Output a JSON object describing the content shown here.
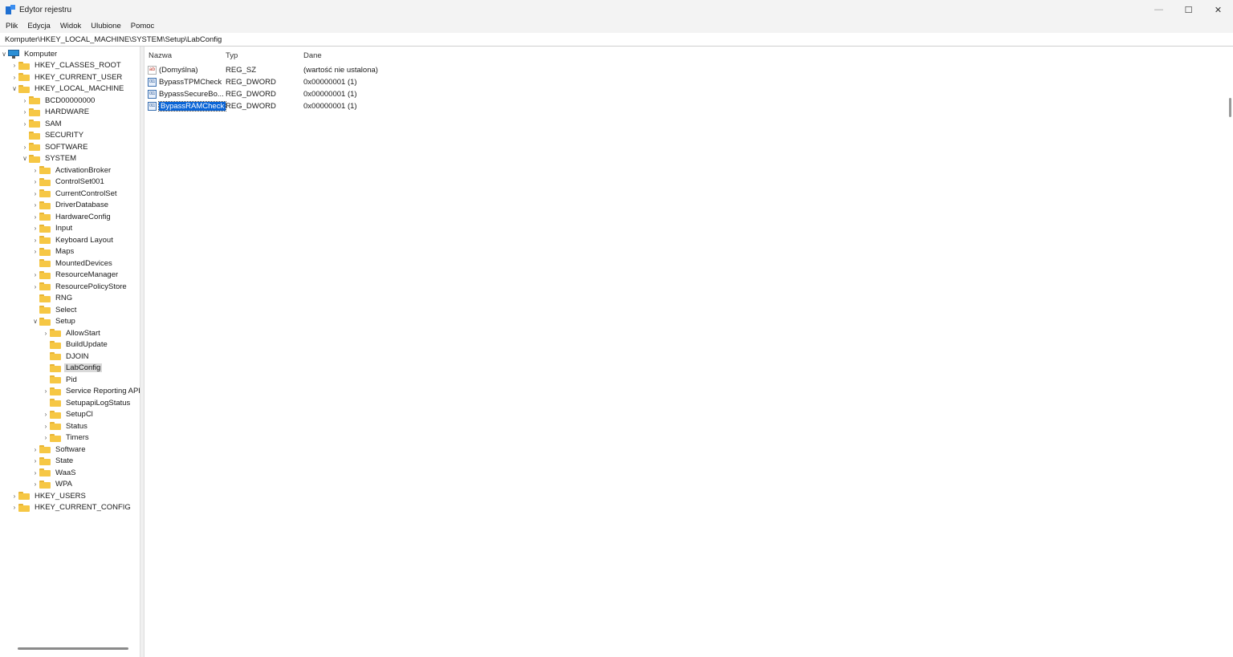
{
  "window": {
    "title": "Edytor rejestru",
    "controls": {
      "minimize": "—",
      "maximize": "☐",
      "close": "✕"
    }
  },
  "menu": [
    "Plik",
    "Edycja",
    "Widok",
    "Ulubione",
    "Pomoc"
  ],
  "address": "Komputer\\HKEY_LOCAL_MACHINE\\SYSTEM\\Setup\\LabConfig",
  "tree": [
    {
      "label": "Komputer",
      "depth": 0,
      "expander": "open",
      "icon": "computer-icon"
    },
    {
      "label": "HKEY_CLASSES_ROOT",
      "depth": 1,
      "expander": "closed",
      "icon": "folder-icon"
    },
    {
      "label": "HKEY_CURRENT_USER",
      "depth": 1,
      "expander": "closed",
      "icon": "folder-icon"
    },
    {
      "label": "HKEY_LOCAL_MACHINE",
      "depth": 1,
      "expander": "open",
      "icon": "folder-icon"
    },
    {
      "label": "BCD00000000",
      "depth": 2,
      "expander": "closed",
      "icon": "folder-icon"
    },
    {
      "label": "HARDWARE",
      "depth": 2,
      "expander": "closed",
      "icon": "folder-icon"
    },
    {
      "label": "SAM",
      "depth": 2,
      "expander": "closed",
      "icon": "folder-icon"
    },
    {
      "label": "SECURITY",
      "depth": 2,
      "expander": "none",
      "icon": "folder-icon"
    },
    {
      "label": "SOFTWARE",
      "depth": 2,
      "expander": "closed",
      "icon": "folder-icon"
    },
    {
      "label": "SYSTEM",
      "depth": 2,
      "expander": "open",
      "icon": "folder-icon"
    },
    {
      "label": "ActivationBroker",
      "depth": 3,
      "expander": "closed",
      "icon": "folder-icon"
    },
    {
      "label": "ControlSet001",
      "depth": 3,
      "expander": "closed",
      "icon": "folder-icon"
    },
    {
      "label": "CurrentControlSet",
      "depth": 3,
      "expander": "closed",
      "icon": "folder-icon"
    },
    {
      "label": "DriverDatabase",
      "depth": 3,
      "expander": "closed",
      "icon": "folder-icon"
    },
    {
      "label": "HardwareConfig",
      "depth": 3,
      "expander": "closed",
      "icon": "folder-icon"
    },
    {
      "label": "Input",
      "depth": 3,
      "expander": "closed",
      "icon": "folder-icon"
    },
    {
      "label": "Keyboard Layout",
      "depth": 3,
      "expander": "closed",
      "icon": "folder-icon"
    },
    {
      "label": "Maps",
      "depth": 3,
      "expander": "closed",
      "icon": "folder-icon"
    },
    {
      "label": "MountedDevices",
      "depth": 3,
      "expander": "none",
      "icon": "folder-icon"
    },
    {
      "label": "ResourceManager",
      "depth": 3,
      "expander": "closed",
      "icon": "folder-icon"
    },
    {
      "label": "ResourcePolicyStore",
      "depth": 3,
      "expander": "closed",
      "icon": "folder-icon"
    },
    {
      "label": "RNG",
      "depth": 3,
      "expander": "none",
      "icon": "folder-icon"
    },
    {
      "label": "Select",
      "depth": 3,
      "expander": "none",
      "icon": "folder-icon"
    },
    {
      "label": "Setup",
      "depth": 3,
      "expander": "open",
      "icon": "folder-icon"
    },
    {
      "label": "AllowStart",
      "depth": 4,
      "expander": "closed",
      "icon": "folder-icon"
    },
    {
      "label": "BuildUpdate",
      "depth": 4,
      "expander": "none",
      "icon": "folder-icon"
    },
    {
      "label": "DJOIN",
      "depth": 4,
      "expander": "none",
      "icon": "folder-icon"
    },
    {
      "label": "LabConfig",
      "depth": 4,
      "expander": "none",
      "icon": "folder-icon",
      "selected": true
    },
    {
      "label": "Pid",
      "depth": 4,
      "expander": "none",
      "icon": "folder-icon"
    },
    {
      "label": "Service Reporting API",
      "depth": 4,
      "expander": "closed",
      "icon": "folder-icon"
    },
    {
      "label": "SetupapiLogStatus",
      "depth": 4,
      "expander": "none",
      "icon": "folder-icon"
    },
    {
      "label": "SetupCl",
      "depth": 4,
      "expander": "closed",
      "icon": "folder-icon"
    },
    {
      "label": "Status",
      "depth": 4,
      "expander": "closed",
      "icon": "folder-icon"
    },
    {
      "label": "Timers",
      "depth": 4,
      "expander": "closed",
      "icon": "folder-icon"
    },
    {
      "label": "Software",
      "depth": 3,
      "expander": "closed",
      "icon": "folder-icon"
    },
    {
      "label": "State",
      "depth": 3,
      "expander": "closed",
      "icon": "folder-icon"
    },
    {
      "label": "WaaS",
      "depth": 3,
      "expander": "closed",
      "icon": "folder-icon"
    },
    {
      "label": "WPA",
      "depth": 3,
      "expander": "closed",
      "icon": "folder-icon"
    },
    {
      "label": "HKEY_USERS",
      "depth": 1,
      "expander": "closed",
      "icon": "folder-icon"
    },
    {
      "label": "HKEY_CURRENT_CONFIG",
      "depth": 1,
      "expander": "closed",
      "icon": "folder-icon"
    }
  ],
  "list": {
    "columns": {
      "name": "Nazwa",
      "type": "Typ",
      "data": "Dane"
    },
    "rows": [
      {
        "name": "(Domyślna)",
        "type": "REG_SZ",
        "data": "(wartość nie ustalona)",
        "icon": "string-value-icon",
        "glyph": "ab"
      },
      {
        "name": "BypassTPMCheck",
        "type": "REG_DWORD",
        "data": "0x00000001 (1)",
        "icon": "dword-value-icon",
        "glyph": "011"
      },
      {
        "name": "BypassSecureBo...",
        "type": "REG_DWORD",
        "data": "0x00000001 (1)",
        "icon": "dword-value-icon",
        "glyph": "011"
      },
      {
        "name": "BypassRAMCheck",
        "type": "REG_DWORD",
        "data": "0x00000001 (1)",
        "icon": "dword-value-icon",
        "glyph": "011",
        "selected": true
      }
    ]
  }
}
